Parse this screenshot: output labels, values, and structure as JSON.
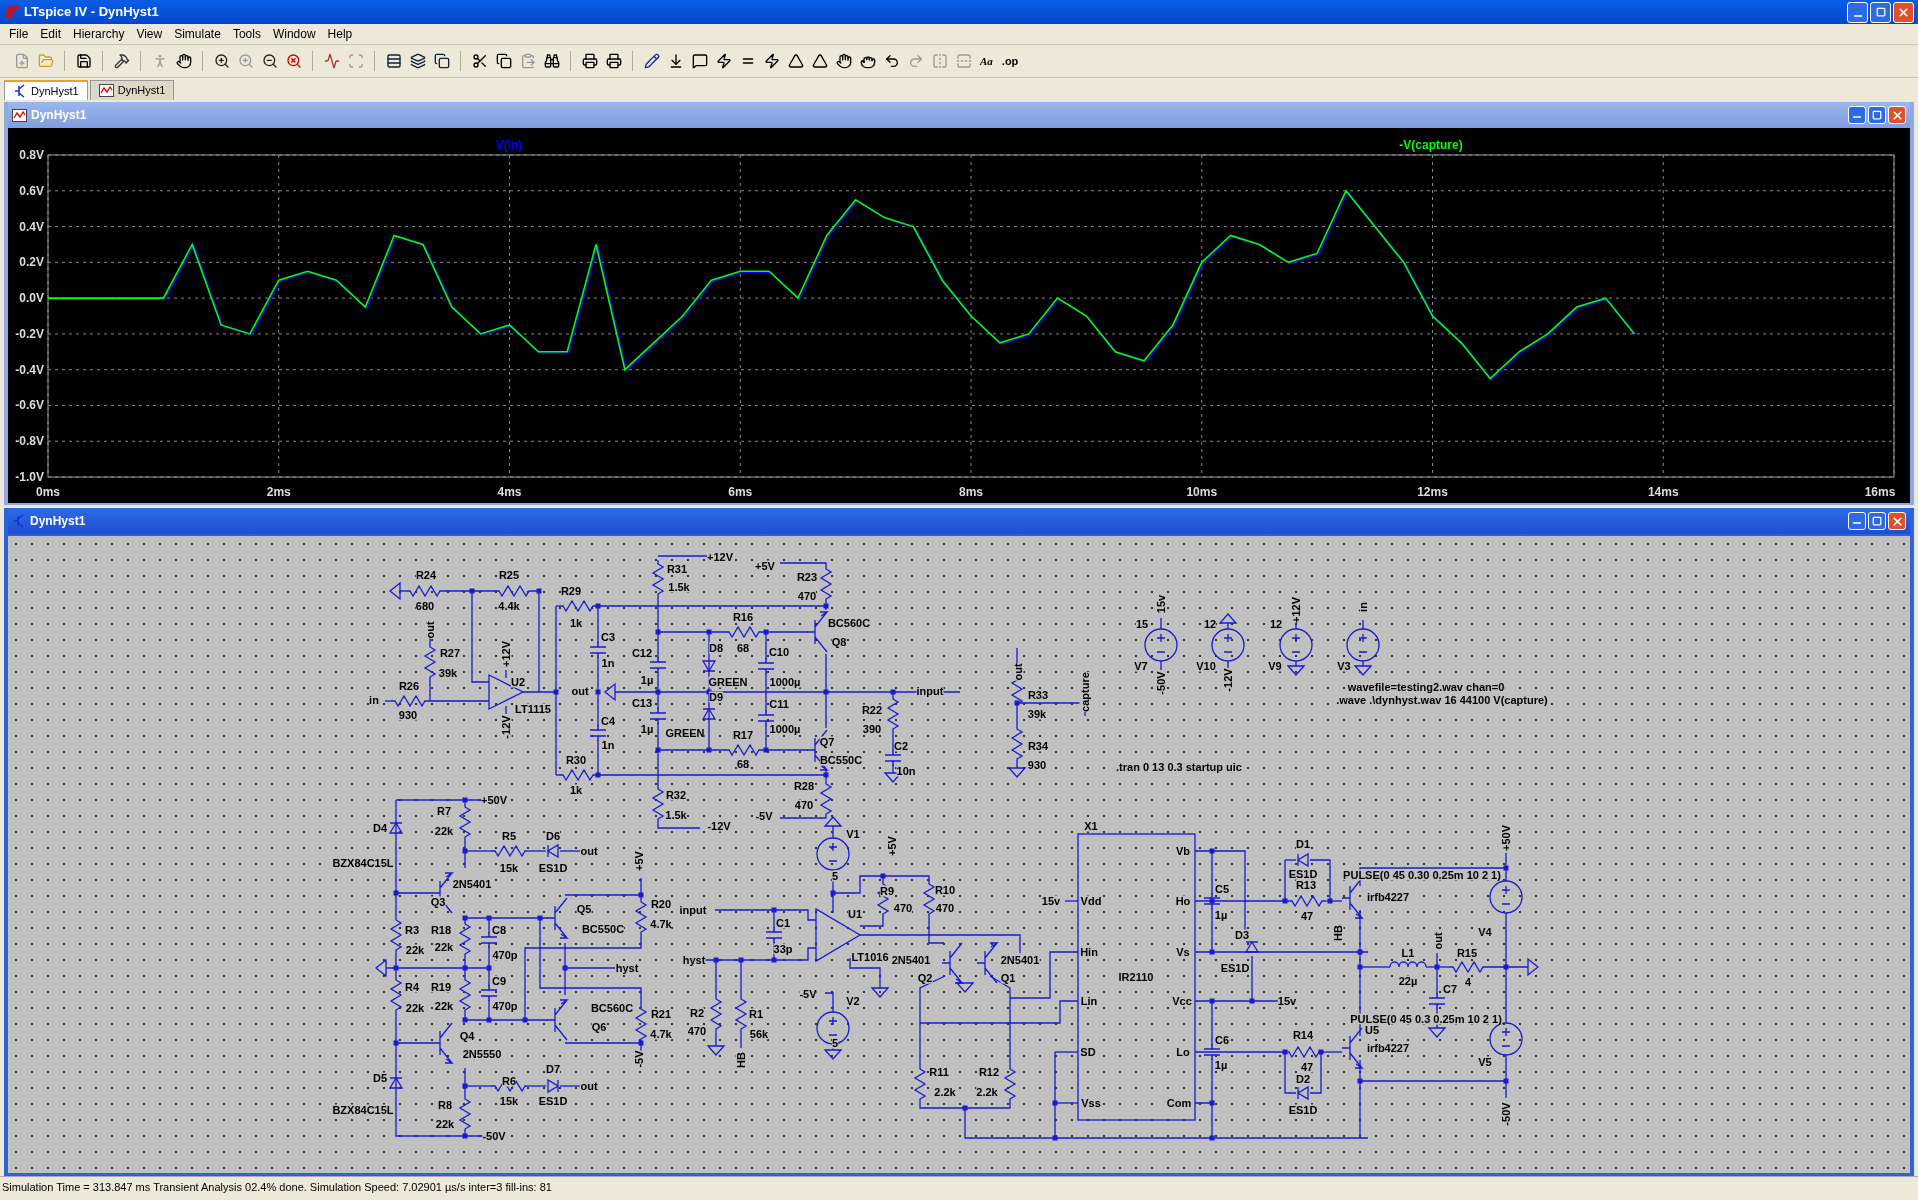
{
  "window": {
    "title": "LTspice IV - DynHyst1"
  },
  "menu": [
    "File",
    "Edit",
    "Hierarchy",
    "View",
    "Simulate",
    "Tools",
    "Window",
    "Help"
  ],
  "toolbar_labels": [
    "Aa",
    ".op"
  ],
  "tabs": [
    {
      "label": "DynHyst1",
      "kind": "schematic",
      "selected": true
    },
    {
      "label": "DynHyst1",
      "kind": "waveform",
      "selected": false
    }
  ],
  "plot_window": {
    "title": "DynHyst1",
    "chart_data": {
      "type": "line",
      "x": [
        0,
        0.25,
        0.5,
        0.75,
        1,
        1.25,
        1.5,
        1.75,
        2,
        2.25,
        2.5,
        2.75,
        3,
        3.25,
        3.5,
        3.75,
        4,
        4.25,
        4.5,
        4.75,
        5,
        5.25,
        5.5,
        5.75,
        6,
        6.25,
        6.5,
        6.75,
        7,
        7.25,
        7.5,
        7.75,
        8,
        8.25,
        8.5,
        8.75,
        9,
        9.25,
        9.5,
        9.75,
        10,
        10.25,
        10.5,
        10.75,
        11,
        11.25,
        11.5,
        11.75,
        12,
        12.25,
        12.5,
        12.75,
        13,
        13.25,
        13.5,
        13.75
      ],
      "series": [
        {
          "name": "V(in)",
          "color": "#0000ff",
          "values": [
            0,
            0,
            0,
            0,
            0,
            0.3,
            -0.15,
            -0.2,
            0.1,
            0.15,
            0.1,
            -0.05,
            0.35,
            0.3,
            -0.05,
            -0.2,
            -0.15,
            -0.3,
            -0.3,
            0.3,
            -0.4,
            -0.25,
            -0.1,
            0.1,
            0.15,
            0.15,
            0,
            0.35,
            0.55,
            0.45,
            0.4,
            0.1,
            -0.1,
            -0.25,
            -0.2,
            0,
            -0.1,
            -0.3,
            -0.35,
            -0.15,
            0.2,
            0.35,
            0.3,
            0.2,
            0.25,
            0.6,
            0.4,
            0.2,
            -0.1,
            -0.25,
            -0.45,
            -0.3,
            -0.2,
            -0.05,
            0,
            -0.2
          ]
        },
        {
          "name": "-V(capture)",
          "color": "#00ff00",
          "values": [
            0,
            0,
            0,
            0,
            0,
            0.3,
            -0.15,
            -0.2,
            0.1,
            0.15,
            0.1,
            -0.05,
            0.35,
            0.3,
            -0.05,
            -0.2,
            -0.15,
            -0.3,
            -0.3,
            0.3,
            -0.4,
            -0.25,
            -0.1,
            0.1,
            0.15,
            0.15,
            0,
            0.35,
            0.55,
            0.45,
            0.4,
            0.1,
            -0.1,
            -0.25,
            -0.2,
            0,
            -0.1,
            -0.3,
            -0.35,
            -0.15,
            0.2,
            0.35,
            0.3,
            0.2,
            0.25,
            0.6,
            0.4,
            0.2,
            -0.1,
            -0.25,
            -0.45,
            -0.3,
            -0.2,
            -0.05,
            0,
            -0.2
          ]
        }
      ],
      "grid": true,
      "xlim": [
        0,
        16
      ],
      "ylim": [
        -1.0,
        0.8
      ],
      "xticks": [
        {
          "value": 0,
          "label": "0ms"
        },
        {
          "value": 2,
          "label": "2ms"
        },
        {
          "value": 4,
          "label": "4ms"
        },
        {
          "value": 6,
          "label": "6ms"
        },
        {
          "value": 8,
          "label": "8ms"
        },
        {
          "value": 10,
          "label": "10ms"
        },
        {
          "value": 12,
          "label": "12ms"
        },
        {
          "value": 14,
          "label": "14ms"
        },
        {
          "value": 16,
          "label": "16ms"
        }
      ],
      "yticks": [
        {
          "value": 0.8,
          "label": "0.8V"
        },
        {
          "value": 0.6,
          "label": "0.6V"
        },
        {
          "value": 0.4,
          "label": "0.4V"
        },
        {
          "value": 0.2,
          "label": "0.2V"
        },
        {
          "value": 0,
          "label": "0.0V"
        },
        {
          "value": -0.2,
          "label": "-0.2V"
        },
        {
          "value": -0.4,
          "label": "-0.4V"
        },
        {
          "value": -0.6,
          "label": "-0.6V"
        },
        {
          "value": -0.8,
          "label": "-0.8V"
        },
        {
          "value": -1.0,
          "label": "-1.0V"
        }
      ]
    }
  },
  "schematic_window": {
    "title": "DynHyst1",
    "labels": [
      "R24",
      "680",
      "R25",
      "4.4k",
      "out",
      "R27",
      "39k",
      "R26",
      "in",
      "930",
      "+12V",
      "U2",
      "LT1115",
      "-12V",
      "R29",
      "1k",
      "C3",
      "1n",
      "out",
      "C4",
      "1n",
      "R30",
      "1k",
      "R31",
      "1.5k",
      "+12V",
      "+5V",
      "R23",
      "470",
      "BC560C",
      "Q8",
      "R16",
      "D8",
      "68",
      "C12",
      "1µ",
      "C10",
      "GREEN",
      "1000µ",
      "C13",
      "D9",
      "C11",
      "1µ",
      "GREEN",
      "1000µ",
      "R17",
      "68",
      "Q7",
      "BC550C",
      "input",
      "R22",
      "390",
      "C2",
      "10n",
      "R28",
      "470",
      "-5V",
      "R32",
      "1.5k",
      "-12V",
      "out",
      "R33",
      "39k",
      "capture",
      "R34",
      "930",
      ".tran 0 13 0.3 startup uic",
      "15v",
      "15",
      "V7",
      "-50V",
      "12",
      "V10",
      "-12V",
      "12",
      "+12V",
      "V9",
      "in",
      "V3",
      "wavefile=testing2.wav chan=0",
      ".wave .\\dynhyst.wav 16 44100 V(capture)",
      "X1",
      "Vb",
      "15v",
      "Vdd",
      "Ho",
      "Hin",
      "Vs",
      "IR2110",
      "Lin",
      "Vcc",
      "SD",
      "Lo",
      "Vss",
      "Com",
      "C5",
      "1µ",
      "D3",
      "ES1D",
      "15v",
      "C6",
      "1µ",
      "D1",
      "ES1D",
      "R13",
      "47",
      "PULSE(0 45 0.30 0.25m 10 2 1)",
      "irfb4227",
      "HB",
      "L1",
      "22µ",
      "out",
      "R15",
      "4",
      "C7",
      "PULSE(0 45 0.3 0.25m 10 2 1)",
      "U5",
      "irfb4227",
      "R14",
      "47",
      "D2",
      "ES1D",
      "+50V",
      "V4",
      "V5",
      "-50V",
      "+50V",
      "R7",
      "D4",
      "22k",
      "BZX84C15L",
      "R5",
      "15k",
      "D6",
      "ES1D",
      "out",
      "2N5401",
      "Q3",
      "+5V",
      "Q5",
      "BC550C",
      "R20",
      "4.7k",
      "R3",
      "22k",
      "R18",
      "22k",
      "C8",
      "470p",
      "hyst",
      "R4",
      "22k",
      "R19",
      "22k",
      "C9",
      "470p",
      "BC560C",
      "R21",
      "Q4",
      "Q6",
      "4.7k",
      "2N5550",
      "-5V",
      "D5",
      "BZX84C15L",
      "R6",
      "15k",
      "D7",
      "ES1D",
      "out",
      "R8",
      "22k",
      "-50V",
      "input",
      "C1",
      "33p",
      "hyst",
      "V1",
      "5",
      "+5V",
      "R9",
      "470",
      "R10",
      "470",
      "U1",
      "LT1016",
      "2N5401",
      "2N5401",
      "Q2",
      "Q1",
      "-5V",
      "V2",
      "5",
      "R2",
      "470",
      "R1",
      "56k",
      "HB",
      "R11",
      "2.2k",
      "R12",
      "2.2k"
    ]
  },
  "status_bar": "Simulation Time = 313.847 ms  Transient Analysis 02.4% done. Simulation Speed: 7.02901 µs/s inter=3 fill-ins: 81"
}
